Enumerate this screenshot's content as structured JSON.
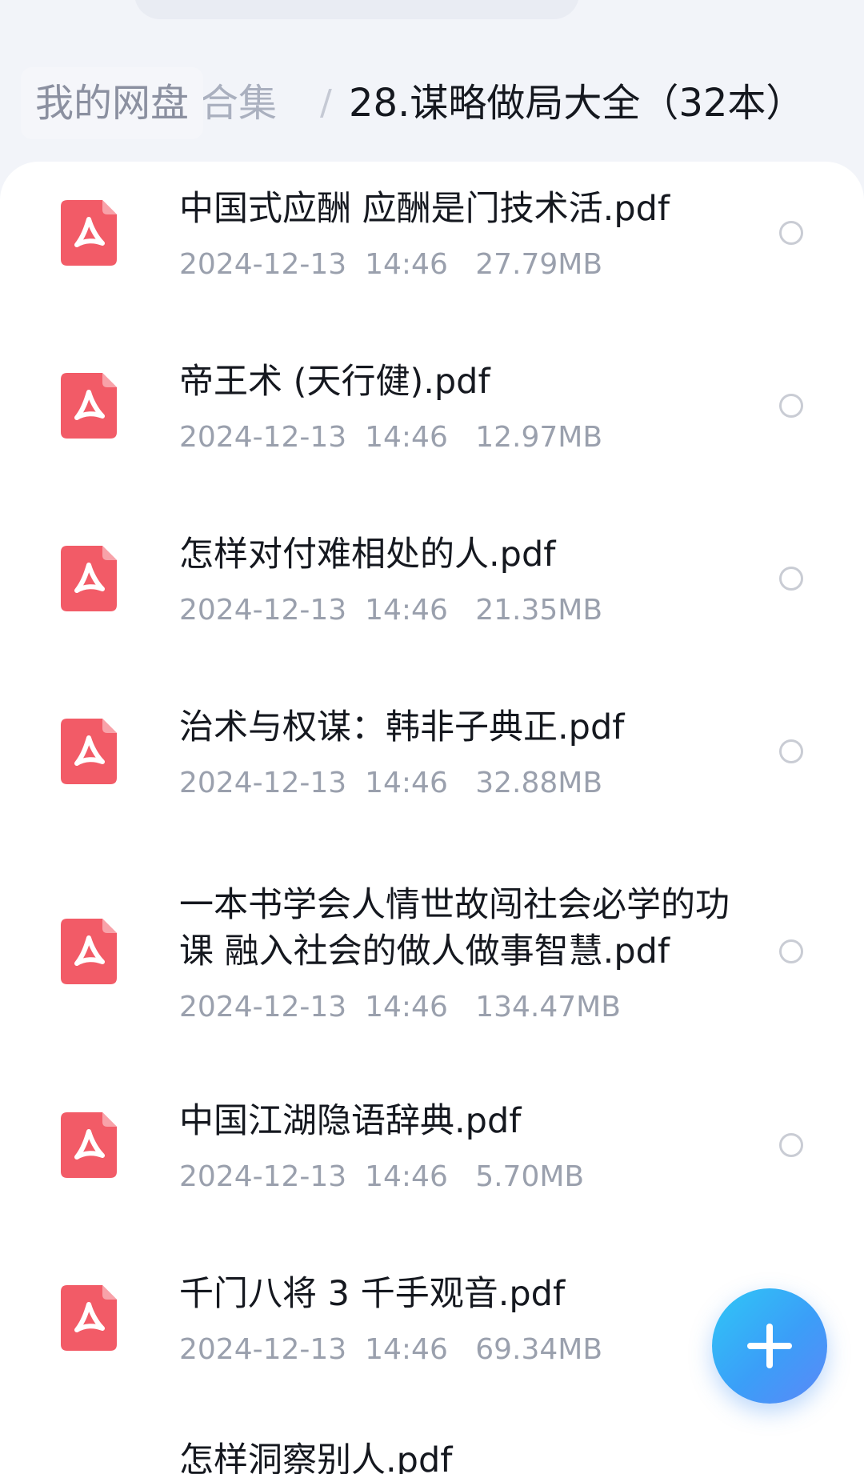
{
  "breadcrumb": {
    "root": "我的网盘",
    "middle": "合集",
    "separator": "/",
    "current": "28.谋略做局大全（32本）"
  },
  "files": [
    {
      "name": "中国式应酬 应酬是门技术活.pdf",
      "date": "2024-12-13",
      "time": "14:46",
      "size": "27.79MB",
      "icon": "pdf-file-icon"
    },
    {
      "name": "帝王术 (天行健).pdf",
      "date": "2024-12-13",
      "time": "14:46",
      "size": "12.97MB",
      "icon": "pdf-file-icon"
    },
    {
      "name": "怎样对付难相处的人.pdf",
      "date": "2024-12-13",
      "time": "14:46",
      "size": "21.35MB",
      "icon": "pdf-file-icon"
    },
    {
      "name": "治术与权谋：韩非子典正.pdf",
      "date": "2024-12-13",
      "time": "14:46",
      "size": "32.88MB",
      "icon": "pdf-file-icon"
    },
    {
      "name": "一本书学会人情世故闯社会必学的功课 融入社会的做人做事智慧.pdf",
      "date": "2024-12-13",
      "time": "14:46",
      "size": "134.47MB",
      "icon": "pdf-file-icon"
    },
    {
      "name": "中国江湖隐语辞典.pdf",
      "date": "2024-12-13",
      "time": "14:46",
      "size": "5.70MB",
      "icon": "pdf-file-icon"
    },
    {
      "name": "千门八将 3 千手观音.pdf",
      "date": "2024-12-13",
      "time": "14:46",
      "size": "69.34MB",
      "icon": "pdf-file-icon"
    },
    {
      "name": "怎样洞察别人.pdf",
      "date": "",
      "time": "",
      "size": "",
      "icon": "pdf-file-icon"
    }
  ],
  "fab": {
    "icon": "plus-icon"
  },
  "colors": {
    "pdf_icon": "#f25b67",
    "fab_start": "#2fc7f6",
    "fab_end": "#5c88f7",
    "text_primary": "#15181f",
    "text_secondary": "#9aa0ad"
  }
}
